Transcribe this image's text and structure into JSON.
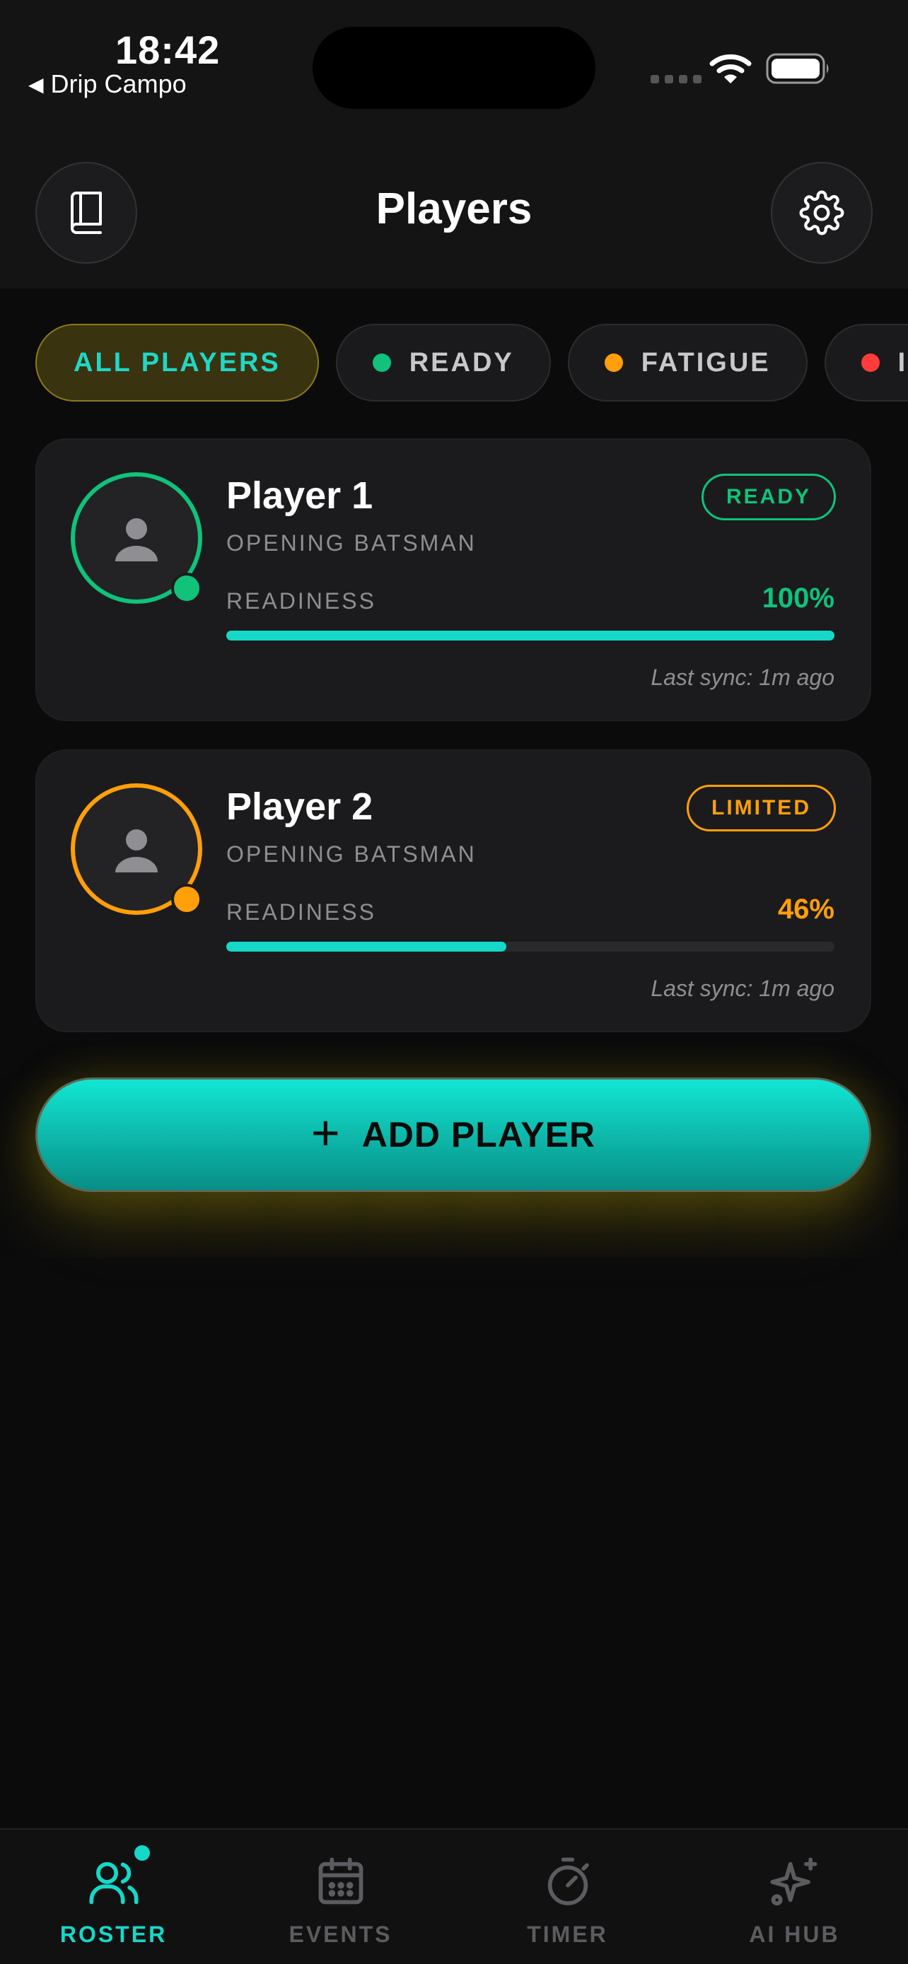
{
  "status_bar": {
    "time": "18:42",
    "back_label": "Drip Campo",
    "back_icon": "back-triangle-icon",
    "wifi_icon": "wifi-icon",
    "battery_icon": "battery-icon"
  },
  "header": {
    "title": "Players",
    "left_icon": "book-icon",
    "right_icon": "gear-icon"
  },
  "filters": [
    {
      "label": "ALL PLAYERS",
      "active": true
    },
    {
      "label": "READY",
      "dot_color": "#10c27a"
    },
    {
      "label": "FATIGUE",
      "dot_color": "#ff9f0a"
    },
    {
      "label": "INJURED",
      "dot_color": "#ff3b3b"
    }
  ],
  "players": [
    {
      "name": "Player 1",
      "role": "OPENING BATSMAN",
      "status": "READY",
      "status_color": "#10c27a",
      "readiness_label": "READINESS",
      "readiness_text": "100%",
      "readiness_value": 100,
      "readiness_color": "#10c27a",
      "last_sync": "Last sync: 1m ago"
    },
    {
      "name": "Player 2",
      "role": "OPENING BATSMAN",
      "status": "LIMITED",
      "status_color": "#ff9f0a",
      "readiness_label": "READINESS",
      "readiness_text": "46%",
      "readiness_value": 46,
      "readiness_color": "#ff9f0a",
      "last_sync": "Last sync: 1m ago"
    }
  ],
  "add_button": {
    "label": "ADD PLAYER",
    "icon": "plus-icon"
  },
  "tabs": [
    {
      "label": "ROSTER",
      "icon": "users-icon",
      "active": true,
      "badge": true
    },
    {
      "label": "EVENTS",
      "icon": "calendar-icon"
    },
    {
      "label": "TIMER",
      "icon": "stopwatch-icon"
    },
    {
      "label": "AI HUB",
      "icon": "sparkle-icon"
    }
  ],
  "colors": {
    "accent": "#16d8c8",
    "background": "#0b0b0c",
    "card": "#1b1b1d",
    "ready": "#10c27a",
    "fatigue": "#ff9f0a",
    "injured": "#ff3b3b"
  }
}
